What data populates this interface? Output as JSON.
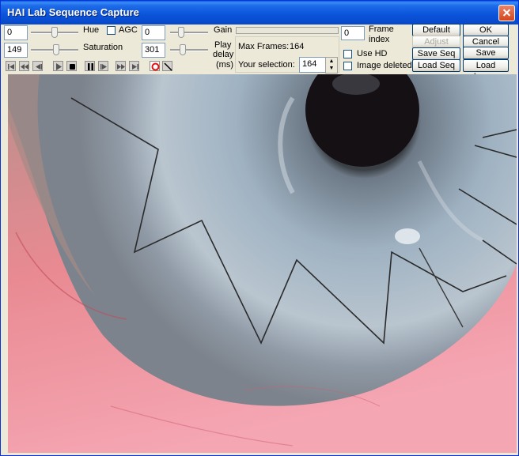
{
  "window": {
    "title": "HAI Lab Sequence Capture"
  },
  "controls": {
    "hue_value": "0",
    "hue_label": "Hue",
    "agc_label": "AGC",
    "gain_value": "0",
    "gain_label": "Gain",
    "saturation_value": "149",
    "saturation_label": "Saturation",
    "play_delay_value": "301",
    "play_delay_label_1": "Play",
    "play_delay_label_2": "delay",
    "play_delay_label_3": "(ms)",
    "max_frames_label": "Max Frames:",
    "max_frames_value": "164",
    "selection_label": "Your selection:",
    "selection_value": "164",
    "frame_index_value": "0",
    "frame_index_label_1": "Frame",
    "frame_index_label_2": "index",
    "use_hd_label": "Use HD",
    "image_deleted_label": "Image deleted"
  },
  "buttons": {
    "default": "Default",
    "ok": "OK",
    "adjust": "Adjust",
    "cancel": "Cancel",
    "save_seq": "Save Seq",
    "save_image": "Save Image",
    "load_seq": "Load Seq",
    "load_image": "Load Image"
  },
  "icons": {
    "transport": [
      "first-frame-icon",
      "rewind-fast-icon",
      "step-back-icon",
      "play-icon",
      "stop-icon",
      "pause-icon",
      "step-forward-icon",
      "forward-fast-icon",
      "last-frame-icon",
      "record-icon",
      "snapshot-icon"
    ]
  },
  "colors": {
    "titlebar": "#0A53DA",
    "record": "#E01010"
  }
}
